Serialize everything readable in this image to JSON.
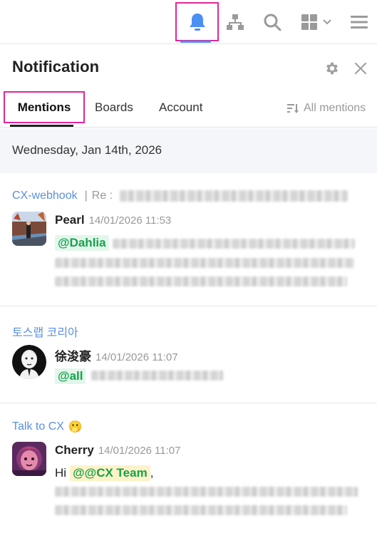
{
  "topbar": {
    "icons": [
      "bell-icon",
      "hierarchy-icon",
      "search-icon",
      "apps-grid-icon",
      "chevron-down-icon",
      "hamburger-menu-icon"
    ],
    "active_color": "#4c8ff3",
    "highlight_color": "#e0269a"
  },
  "panel": {
    "title": "Notification",
    "icons": [
      "gear-icon",
      "close-icon"
    ]
  },
  "tabs": [
    {
      "label": "Mentions",
      "active": true
    },
    {
      "label": "Boards",
      "active": false
    },
    {
      "label": "Account",
      "active": false
    }
  ],
  "filter": {
    "label": "All mentions",
    "icon": "sort-filter-icon"
  },
  "date_header": "Wednesday, Jan 14th, 2026",
  "notifications": [
    {
      "channel": "CX-webhook",
      "separator": "|",
      "subject_prefix": "Re :",
      "sender": "Pearl",
      "time": "14/01/2026 11:53",
      "mention": "@Dahlia",
      "prefix": ""
    },
    {
      "channel": "토스랩 코리아",
      "sender": "徐浚豪",
      "time": "14/01/2026 11:07",
      "mention": "@all",
      "prefix": ""
    },
    {
      "channel": "Talk to CX",
      "channel_emoji": "🫢",
      "sender": "Cherry",
      "time": "14/01/2026 11:07",
      "prefix": "Hi",
      "mention": "@@CX Team",
      "suffix": ","
    }
  ]
}
